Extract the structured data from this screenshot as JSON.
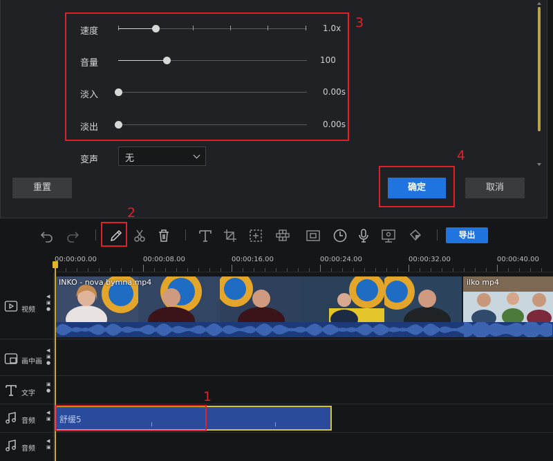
{
  "panel": {
    "speed": {
      "label": "速度",
      "value": "1.0x",
      "level": 0.2
    },
    "volume": {
      "label": "音量",
      "value": "100",
      "level": 0.26
    },
    "fade_in": {
      "label": "淡入",
      "value": "0.00s",
      "level": 0.0
    },
    "fade_out": {
      "label": "淡出",
      "value": "0.00s",
      "level": 0.0
    },
    "voice_change": {
      "label": "变声",
      "selected": "无"
    },
    "reset_label": "重置",
    "ok_label": "确定",
    "cancel_label": "取消"
  },
  "callouts": [
    "1",
    "2",
    "3",
    "4"
  ],
  "toolbar": {
    "icons": [
      "undo-icon",
      "redo-icon",
      "edit-pencil-icon",
      "scissors-icon",
      "trash-icon",
      "text-icon",
      "crop-icon",
      "zoom-icon",
      "mosaic-icon",
      "freeze-frame-icon",
      "duration-icon",
      "voiceover-mic-icon",
      "screenshot-icon",
      "color-fill-icon"
    ],
    "export_label": "导出"
  },
  "ruler": {
    "labels": [
      "00:00:00.00",
      "00:00:08.00",
      "00:00:16.00",
      "00:00:24.00",
      "00:00:32.00",
      "00:00:40.00"
    ]
  },
  "tracks": {
    "video": "视频",
    "pip": "画中画",
    "text": "文字",
    "audio1": "音频",
    "audio2": "音频"
  },
  "clips": {
    "video_title": "INKO - nova bymna.mp4",
    "video_title_second": "ilko mp4",
    "audio_title": "舒缓5"
  },
  "colors": {
    "accent": "#1f74e0",
    "callout": "#e0202a",
    "playhead": "#c8ab2a",
    "audio_clip": "#2a4a9c"
  }
}
